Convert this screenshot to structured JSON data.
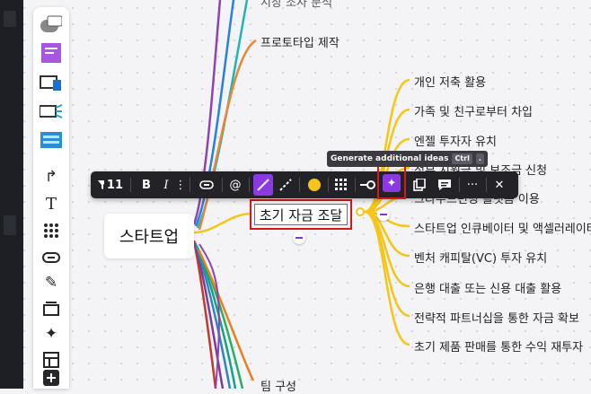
{
  "mindmap": {
    "root": "스타트업",
    "selected": "초기 자금 조달",
    "top_cut_label": "시장 조사 분석",
    "prototype": "프로토타입 제작",
    "bottom": "팀 구성",
    "children": [
      "개인 저축 활용",
      "가족 및 친구로부터 차입",
      "엔젤 투자자 유치",
      "정부 지원금 및 보조금 신청",
      "크라우드펀딩 플랫폼 이용",
      "스타트업 인큐베이터 및 액셀러레이터",
      "벤처 캐피탈(VC) 투자 유치",
      "은행 대출 또는 신용 대출 활용",
      "전략적 파트너십을 통한 자금 확보",
      "초기 제품 판매를 통한 수익 재투자"
    ]
  },
  "toolbar": {
    "font_size": "11",
    "bold": "B",
    "italic": "I",
    "at": "@",
    "more": "···",
    "close": "✕",
    "tooltip_text": "Generate additional ideas",
    "tooltip_key": "Ctrl",
    "tooltip_key2": ".",
    "accent": "#8a3ae0",
    "dot_color": "#f5c518"
  },
  "dock_tools": [
    "templates-icon",
    "sticky-note-icon",
    "card-icon",
    "frame-icon",
    "embed-icon",
    "connector-arrow-icon",
    "text-icon",
    "grid-icon",
    "link-icon",
    "pen-icon",
    "frames-icon",
    "ai-sparkle-icon",
    "layout-icon",
    "plus-icon"
  ],
  "colors": {
    "branch_yellow": "#f5c518",
    "selected_outline": "#d21a1a"
  }
}
